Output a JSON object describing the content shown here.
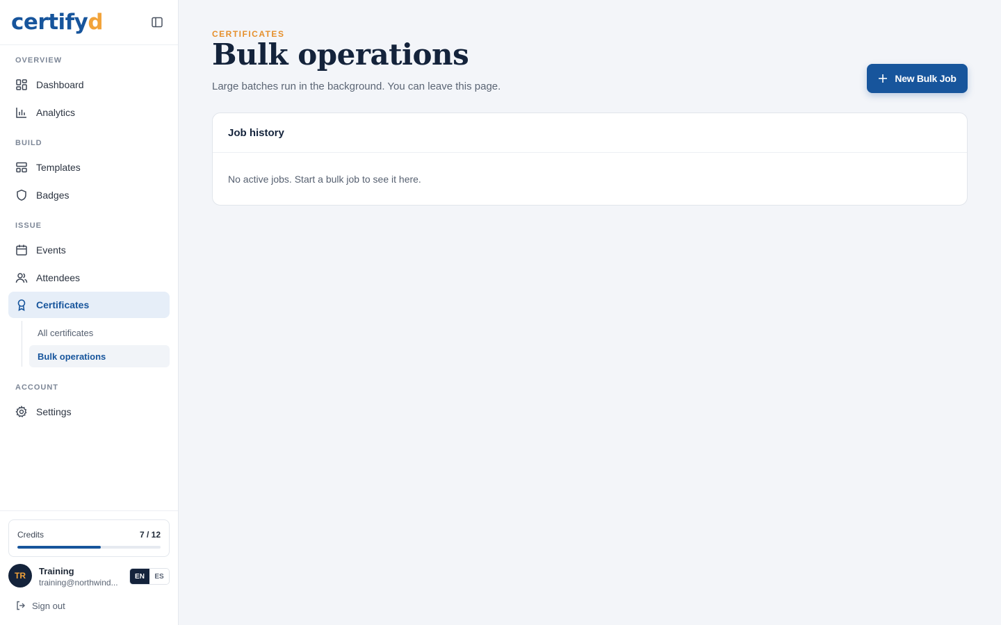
{
  "brand": {
    "logo_main": "certify",
    "logo_accent": "d"
  },
  "sidebar": {
    "sections": {
      "overview": "OVERVIEW",
      "build": "BUILD",
      "issue": "ISSUE",
      "account": "ACCOUNT"
    },
    "items": {
      "dashboard": {
        "label": "Dashboard",
        "icon": "dashboard-icon"
      },
      "analytics": {
        "label": "Analytics",
        "icon": "bar-chart-icon"
      },
      "templates": {
        "label": "Templates",
        "icon": "layout-icon"
      },
      "badges": {
        "label": "Badges",
        "icon": "shield-icon"
      },
      "events": {
        "label": "Events",
        "icon": "calendar-icon"
      },
      "attendees": {
        "label": "Attendees",
        "icon": "users-icon"
      },
      "certificates": {
        "label": "Certificates",
        "icon": "award-icon",
        "active": true
      },
      "settings": {
        "label": "Settings",
        "icon": "gear-icon"
      }
    },
    "subitems": {
      "all_certificates": "All certificates",
      "bulk_operations": "Bulk operations"
    },
    "credits": {
      "label": "Credits",
      "value": "7 / 12",
      "used": 7,
      "total": 12
    },
    "user": {
      "initials": "TR",
      "name": "Training",
      "email": "training@northwind..."
    },
    "languages": {
      "active": "EN",
      "other": "ES"
    },
    "sign_out": "Sign out"
  },
  "main": {
    "eyebrow": "CERTIFICATES",
    "title": "Bulk operations",
    "subtitle": "Large batches run in the background. You can leave this page.",
    "new_job_button": "New Bulk Job",
    "job_history": {
      "title": "Job history",
      "empty_message": "No active jobs. Start a bulk job to see it here."
    }
  },
  "colors": {
    "brand_blue": "#17559c",
    "brand_orange": "#f2a33a",
    "background": "#f3f5f9",
    "navy": "#14233b"
  }
}
